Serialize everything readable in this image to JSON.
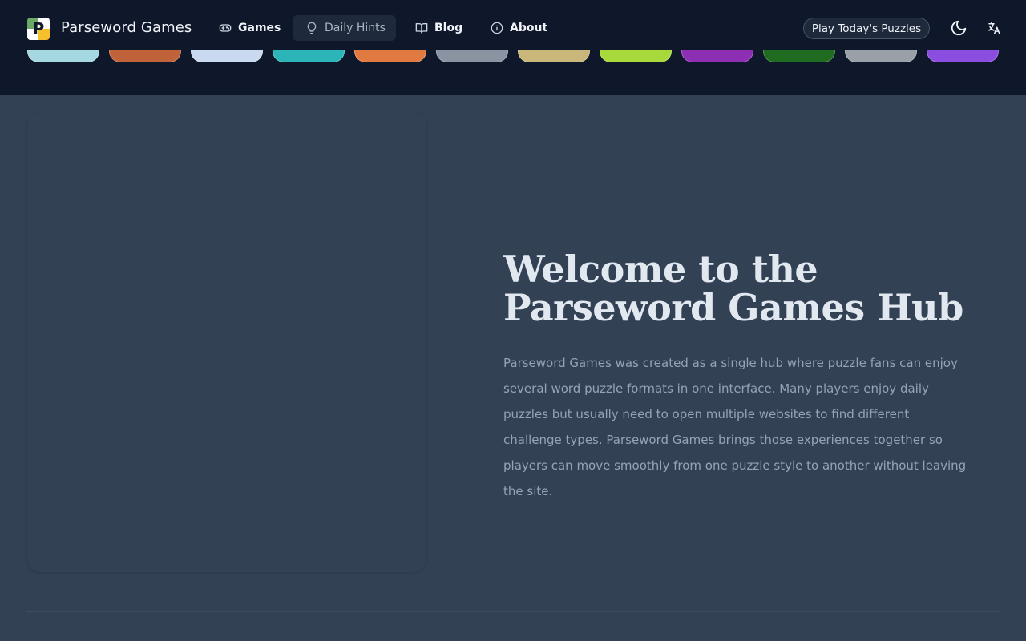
{
  "header": {
    "brand": "Parseword Games",
    "logo_letter": "P",
    "nav": [
      {
        "label": "Games",
        "icon": "gamepad-icon"
      },
      {
        "label": "Daily Hints",
        "icon": "lightbulb-icon",
        "active": true
      },
      {
        "label": "Blog",
        "icon": "book-open-icon"
      },
      {
        "label": "About",
        "icon": "info-icon"
      }
    ],
    "cta_label": "Play Today's Puzzles",
    "theme_icon": "moon-icon",
    "language_icon": "translate-icon"
  },
  "game_strip": {
    "thumb_colors": [
      "#a5d8e0",
      "#c0623a",
      "#c9d9ef",
      "#2bb5b8",
      "#e07a40",
      "#8b93a3",
      "#c8b67a",
      "#a8d93a",
      "#8e2fb3",
      "#1f6b1f",
      "#9aa0a8",
      "#8a4de0"
    ]
  },
  "hero": {
    "title_line1": "Welcome to the",
    "title_line2": "Parseword Games Hub",
    "paragraph": "Parseword Games was created as a single hub where puzzle fans can enjoy several word puzzle formats in one interface. Many players enjoy daily puzzles but usually need to open multiple websites to find different challenge types. Parseword Games brings those experiences together so players can move smoothly from one puzzle style to another without leaving the site."
  },
  "colors": {
    "header_bg": "#0f172a",
    "page_bg": "#334155",
    "title": "#e2e8f0",
    "body_text": "#94a3b8"
  }
}
